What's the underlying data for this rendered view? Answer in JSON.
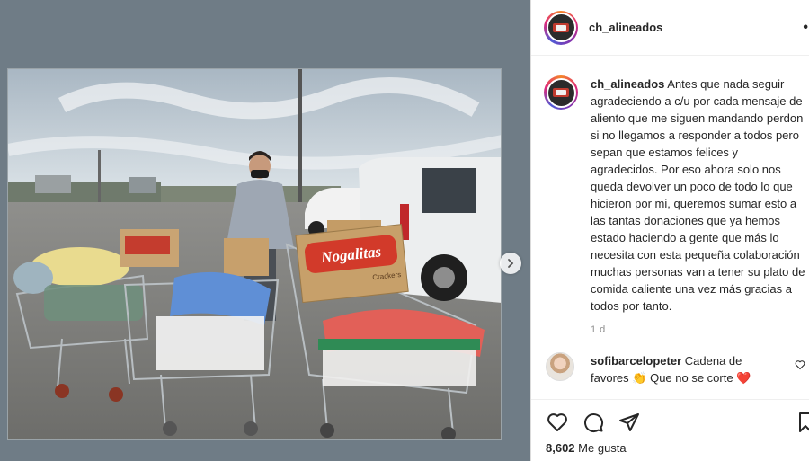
{
  "account": {
    "username": "ch_alineados",
    "more_label": "•"
  },
  "post": {
    "caption_author": "ch_alineados",
    "caption_body": "Antes que nada seguir agradeciendo a c/u por cada mensaje de aliento que me siguen mandando perdon si no llegamos a responder a todos pero sepan que estamos felices y agradecidos. Por eso ahora solo nos queda devolver un poco de todo lo que hicieron por mi, queremos sumar esto a las tantas donaciones que ya hemos estado haciendo a gente que más lo necesita con esta pequeña colaboración muchas personas van a tener su plato de comida caliente una vez más gracias a todos por tanto.",
    "timestamp": "1 d",
    "likes_count": "8,602",
    "likes_label": "Me gusta",
    "photo_box_brand": "Nogalitas",
    "photo_box_sub": "Crackers"
  },
  "comments": [
    {
      "author": "sofibarcelopeter",
      "text_before": "Cadena de favores",
      "emoji1": "👏",
      "text_after": "Que no se corte",
      "emoji2": "❤️"
    }
  ],
  "icons": {
    "like": "heart-icon",
    "comment": "comment-icon",
    "share": "share-icon",
    "save": "bookmark-icon",
    "next": "chevron-right-icon"
  },
  "colors": {
    "text": "#262626",
    "muted": "#8e8e8e",
    "divider": "#efefef",
    "story_ring": "#dd2a7b"
  }
}
